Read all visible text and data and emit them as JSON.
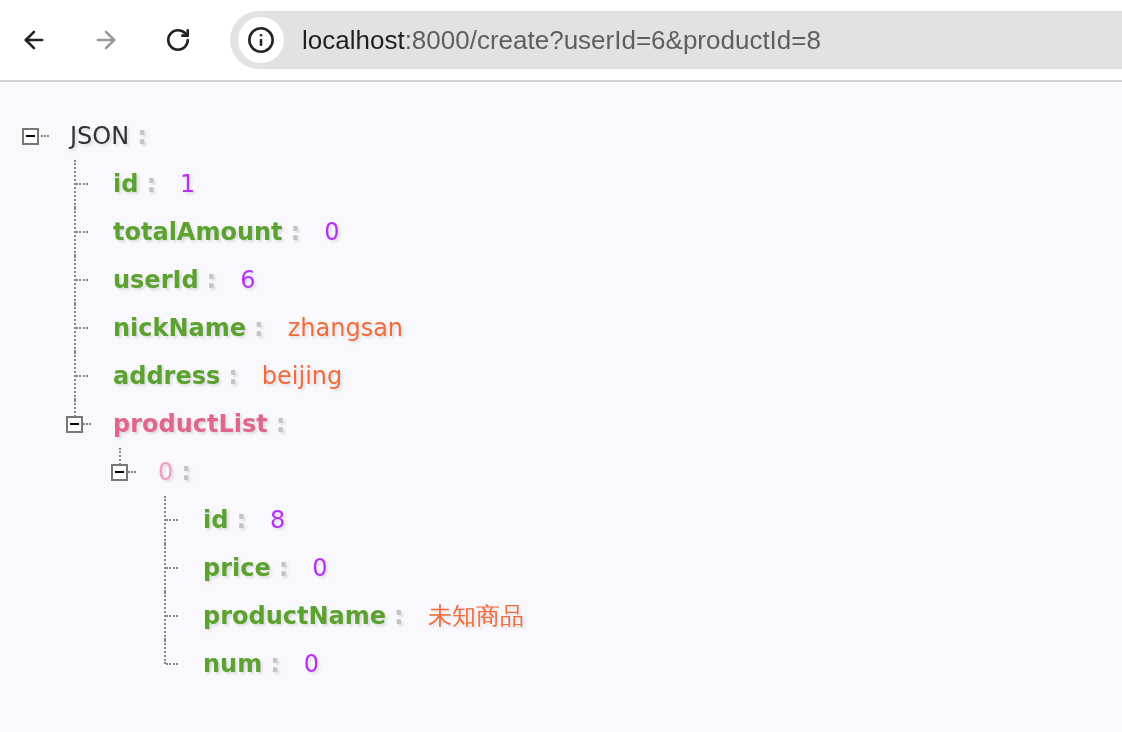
{
  "toolbar": {
    "back": {
      "disabled": false
    },
    "forward": {
      "disabled": true
    },
    "address": {
      "host": "localhost",
      "rest": ":8000/create?userId=6&productId=8"
    }
  },
  "tree": {
    "key": "JSON",
    "kind": "root",
    "separator": ":",
    "expanded": true,
    "children": [
      {
        "key": "id",
        "kind": "number",
        "separator": ":",
        "value": "1"
      },
      {
        "key": "totalAmount",
        "kind": "number",
        "separator": ":",
        "value": "0"
      },
      {
        "key": "userId",
        "kind": "number",
        "separator": ":",
        "value": "6"
      },
      {
        "key": "nickName",
        "kind": "string",
        "separator": ":",
        "value": "zhangsan"
      },
      {
        "key": "address",
        "kind": "string",
        "separator": ":",
        "value": "beijing"
      },
      {
        "key": "productList",
        "kind": "array",
        "separator": ":",
        "expanded": true,
        "children": [
          {
            "key": "0",
            "kind": "index",
            "separator": ":",
            "expanded": true,
            "children": [
              {
                "key": "id",
                "kind": "number",
                "separator": ":",
                "value": "8"
              },
              {
                "key": "price",
                "kind": "number",
                "separator": ":",
                "value": "0"
              },
              {
                "key": "productName",
                "kind": "string",
                "separator": ":",
                "value": "未知商品"
              },
              {
                "key": "num",
                "kind": "number",
                "separator": ":",
                "value": "0"
              }
            ]
          }
        ]
      }
    ]
  }
}
